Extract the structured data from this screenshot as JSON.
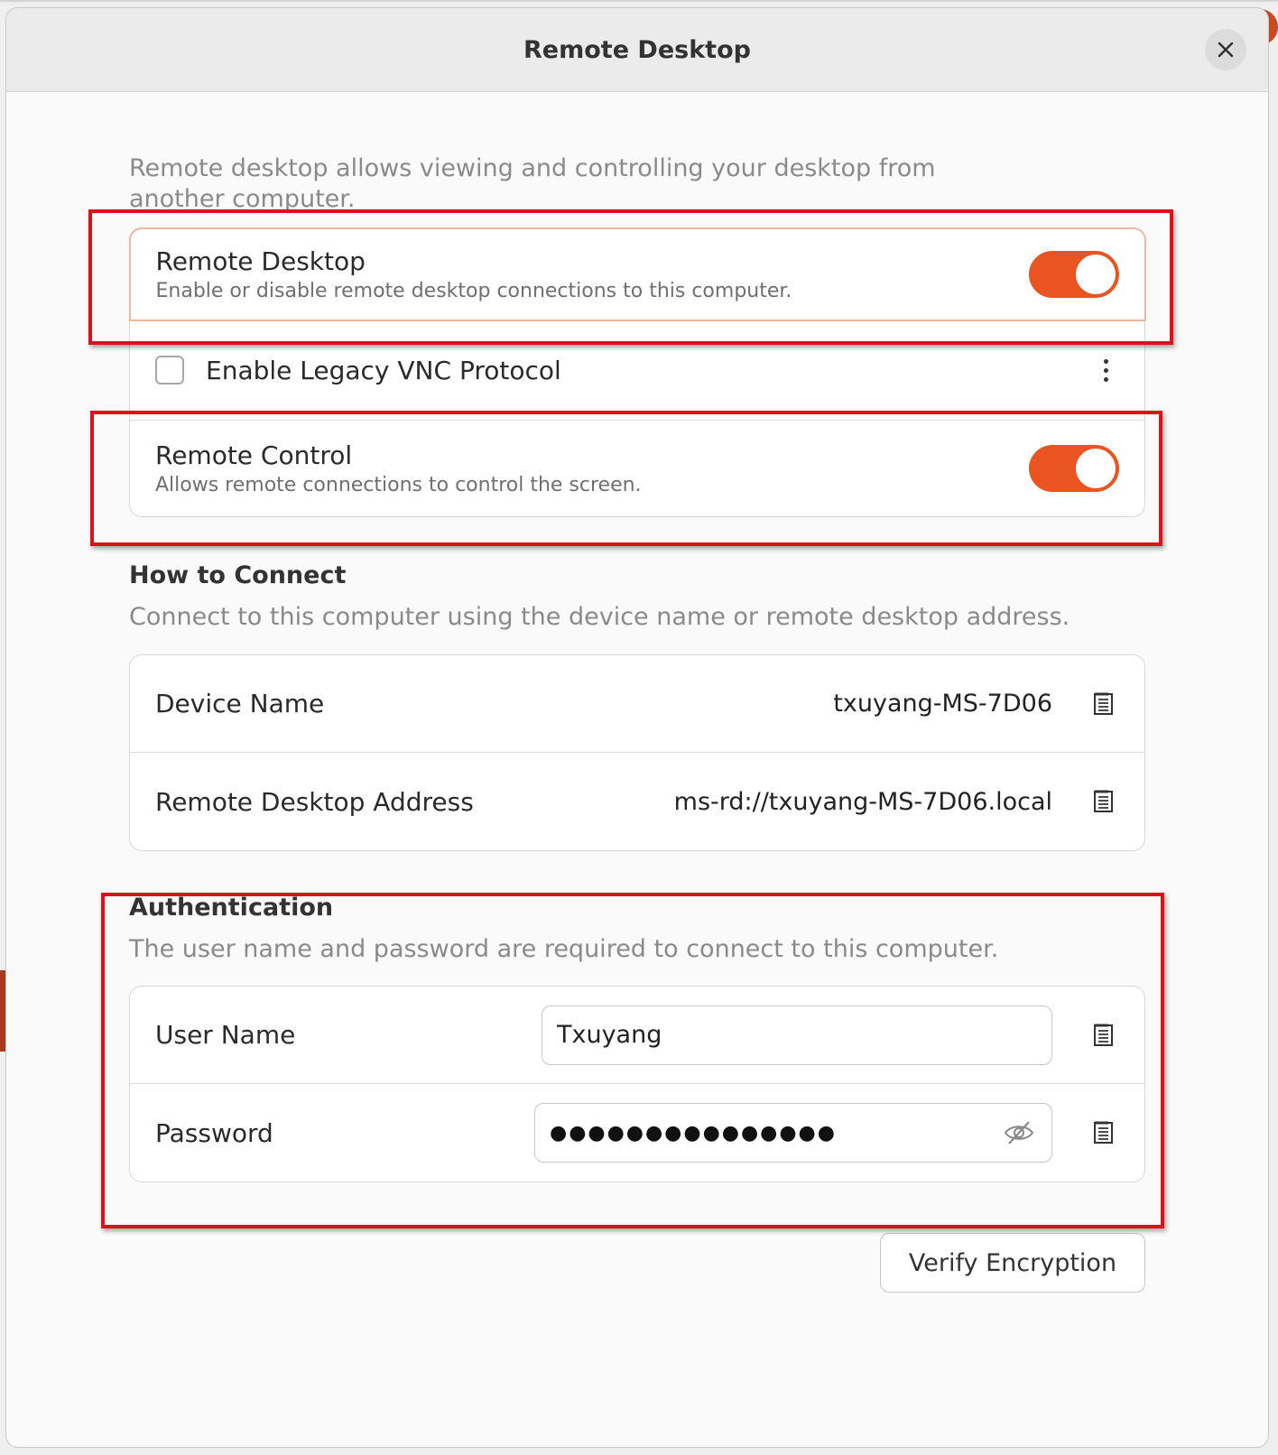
{
  "dialog": {
    "title": "Remote Desktop",
    "close_icon": "close-icon"
  },
  "intro_text": "Remote desktop allows viewing and controlling your desktop from another computer.",
  "sharing": {
    "remote_desktop": {
      "title": "Remote Desktop",
      "subtitle": "Enable or disable remote desktop connections to this computer.",
      "enabled": true
    },
    "legacy_vnc": {
      "label": "Enable Legacy VNC Protocol",
      "checked": false,
      "menu_icon": "kebab-menu-icon"
    },
    "remote_control": {
      "title": "Remote Control",
      "subtitle": "Allows remote connections to control the screen.",
      "enabled": true
    }
  },
  "how_to_connect": {
    "heading": "How to Connect",
    "description": "Connect to this computer using the device name or remote desktop address.",
    "device_name_label": "Device Name",
    "device_name_value": "txuyang-MS-7D06",
    "address_label": "Remote Desktop Address",
    "address_value": "ms-rd://txuyang-MS-7D06.local",
    "copy_icon": "copy-icon"
  },
  "authentication": {
    "heading": "Authentication",
    "description": "The user name and password are required to connect to this computer.",
    "username_label": "User Name",
    "username_value": "Txuyang",
    "password_label": "Password",
    "password_masked": "●●●●●●●●●●●●●●●",
    "reveal_icon": "eye-hidden-icon"
  },
  "verify_button": "Verify Encryption",
  "colors": {
    "accent": "#e95420",
    "highlight": "#e0101a"
  }
}
